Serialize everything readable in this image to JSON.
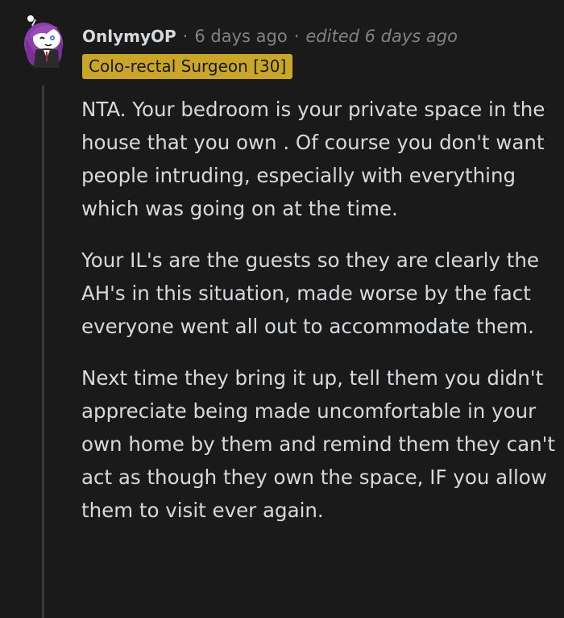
{
  "comment": {
    "username": "OnlymyOP",
    "separator": "·",
    "timestamp": "6 days ago",
    "edited": "edited 6 days ago",
    "flair": "Colo-rectal Surgeon [30]",
    "paragraphs": [
      "NTA. Your bedroom is your private space in the house that you own . Of course you don't want people intruding, especially with everything which was going on at the time.",
      "Your IL's are the guests so they are clearly the AH's in this situation, made worse by the fact everyone went all out to accommodate them.",
      "Next time they bring it up, tell them you didn't appreciate being made uncomfortable in your own home by them and remind them they can't act as though they own the space, IF you allow them to visit ever again."
    ]
  },
  "colors": {
    "background": "#1a1a1b",
    "text": "#d7dadc",
    "muted": "#818384",
    "flair_bg": "#c9a62a",
    "avatar_hair": "#8b3fa8"
  },
  "icons": {
    "avatar": "snoo-avatar-icon"
  }
}
